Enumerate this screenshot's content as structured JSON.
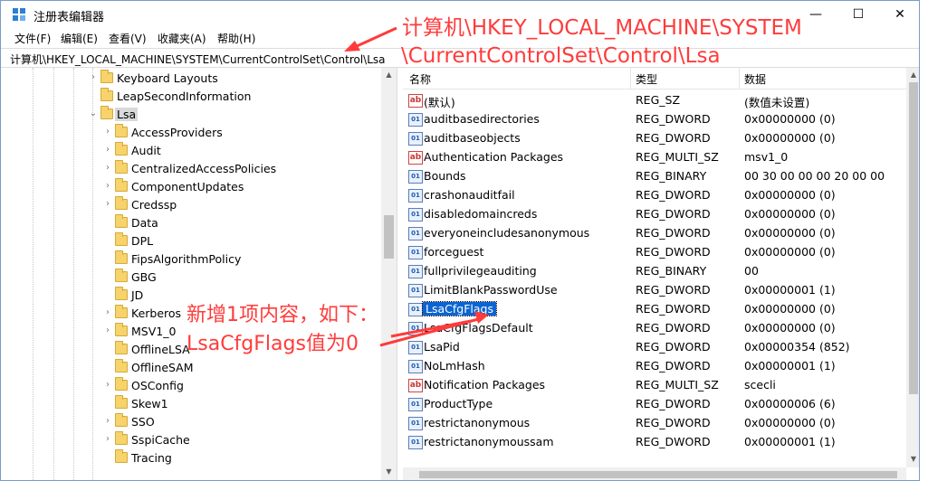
{
  "window": {
    "title": "注册表编辑器",
    "controls": {
      "minimize": "—",
      "maximize": "☐",
      "close": "✕"
    }
  },
  "menu": [
    "文件(F)",
    "编辑(E)",
    "查看(V)",
    "收藏夹(A)",
    "帮助(H)"
  ],
  "address": "计算机\\HKEY_LOCAL_MACHINE\\SYSTEM\\CurrentControlSet\\Control\\Lsa",
  "tree": {
    "items": [
      {
        "label": "Keyboard Layouts",
        "expand": "›"
      },
      {
        "label": "LeapSecondInformation",
        "expand": ""
      },
      {
        "label": "Lsa",
        "expand": "⌄"
      },
      {
        "label": "AccessProviders",
        "expand": "›"
      },
      {
        "label": "Audit",
        "expand": "›"
      },
      {
        "label": "CentralizedAccessPolicies",
        "expand": "›"
      },
      {
        "label": "ComponentUpdates",
        "expand": "›"
      },
      {
        "label": "Credssp",
        "expand": "›"
      },
      {
        "label": "Data",
        "expand": ""
      },
      {
        "label": "DPL",
        "expand": ""
      },
      {
        "label": "FipsAlgorithmPolicy",
        "expand": ""
      },
      {
        "label": "GBG",
        "expand": ""
      },
      {
        "label": "JD",
        "expand": ""
      },
      {
        "label": "Kerberos",
        "expand": "›"
      },
      {
        "label": "MSV1_0",
        "expand": "›"
      },
      {
        "label": "OfflineLSA",
        "expand": ""
      },
      {
        "label": "OfflineSAM",
        "expand": ""
      },
      {
        "label": "OSConfig",
        "expand": "›"
      },
      {
        "label": "Skew1",
        "expand": ""
      },
      {
        "label": "SSO",
        "expand": "›"
      },
      {
        "label": "SspiCache",
        "expand": "›"
      },
      {
        "label": "Tracing",
        "expand": ""
      }
    ],
    "selected": "Lsa"
  },
  "list": {
    "headers": {
      "name": "名称",
      "type": "类型",
      "data": "数据"
    },
    "rows": [
      {
        "icon": "ab",
        "name": "(默认)",
        "type": "REG_SZ",
        "data": "(数值未设置)"
      },
      {
        "icon": "bin",
        "name": "auditbasedirectories",
        "type": "REG_DWORD",
        "data": "0x00000000 (0)"
      },
      {
        "icon": "bin",
        "name": "auditbaseobjects",
        "type": "REG_DWORD",
        "data": "0x00000000 (0)"
      },
      {
        "icon": "ab",
        "name": "Authentication Packages",
        "type": "REG_MULTI_SZ",
        "data": "msv1_0"
      },
      {
        "icon": "bin",
        "name": "Bounds",
        "type": "REG_BINARY",
        "data": "00 30 00 00 00 20 00 00"
      },
      {
        "icon": "bin",
        "name": "crashonauditfail",
        "type": "REG_DWORD",
        "data": "0x00000000 (0)"
      },
      {
        "icon": "bin",
        "name": "disabledomaincreds",
        "type": "REG_DWORD",
        "data": "0x00000000 (0)"
      },
      {
        "icon": "bin",
        "name": "everyoneincludesanonymous",
        "type": "REG_DWORD",
        "data": "0x00000000 (0)"
      },
      {
        "icon": "bin",
        "name": "forceguest",
        "type": "REG_DWORD",
        "data": "0x00000000 (0)"
      },
      {
        "icon": "bin",
        "name": "fullprivilegeauditing",
        "type": "REG_BINARY",
        "data": "00"
      },
      {
        "icon": "bin",
        "name": "LimitBlankPasswordUse",
        "type": "REG_DWORD",
        "data": "0x00000001 (1)"
      },
      {
        "icon": "bin",
        "name": "LsaCfgFlags",
        "type": "REG_DWORD",
        "data": "0x00000000 (0)"
      },
      {
        "icon": "bin",
        "name": "LsaCfgFlagsDefault",
        "type": "REG_DWORD",
        "data": "0x00000000 (0)"
      },
      {
        "icon": "bin",
        "name": "LsaPid",
        "type": "REG_DWORD",
        "data": "0x00000354 (852)"
      },
      {
        "icon": "bin",
        "name": "NoLmHash",
        "type": "REG_DWORD",
        "data": "0x00000001 (1)"
      },
      {
        "icon": "ab",
        "name": "Notification Packages",
        "type": "REG_MULTI_SZ",
        "data": "scecli"
      },
      {
        "icon": "bin",
        "name": "ProductType",
        "type": "REG_DWORD",
        "data": "0x00000006 (6)"
      },
      {
        "icon": "bin",
        "name": "restrictanonymous",
        "type": "REG_DWORD",
        "data": "0x00000000 (0)"
      },
      {
        "icon": "bin",
        "name": "restrictanonymoussam",
        "type": "REG_DWORD",
        "data": "0x00000001 (1)"
      }
    ],
    "selected": "LsaCfgFlags"
  },
  "annotations": {
    "path_line1": "计算机\\HKEY_LOCAL_MACHINE\\SYSTEM",
    "path_line2": "\\CurrentControlSet\\Control\\Lsa",
    "note_line1": "新增1项内容，如下：",
    "note_line2": "LsaCfgFlags值为0"
  },
  "colors": {
    "annotation": "#ff3b3b",
    "selection": "#0a64d2"
  }
}
